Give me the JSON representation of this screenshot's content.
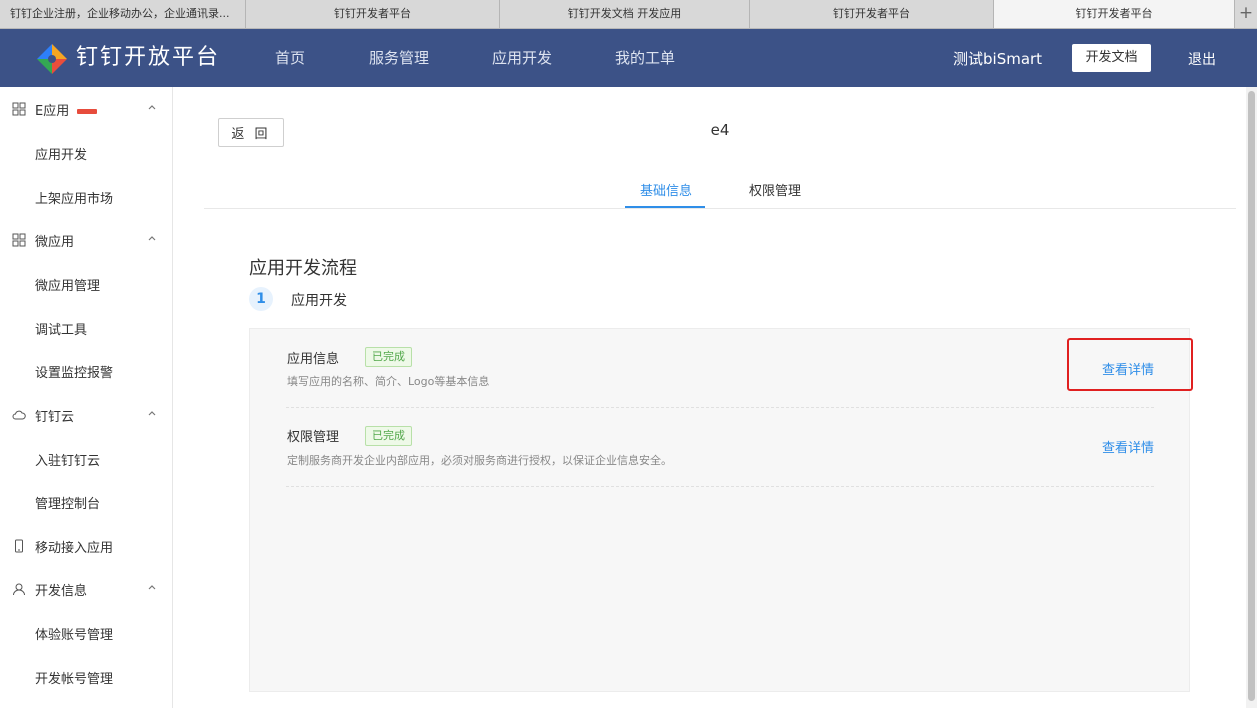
{
  "browser": {
    "tabs": [
      {
        "label": "钉钉企业注册，企业移动办公，企业通讯录..."
      },
      {
        "label": "钉钉开发者平台"
      },
      {
        "label": "钉钉开发文档 开发应用"
      },
      {
        "label": "钉钉开发者平台"
      },
      {
        "label": "钉钉开发者平台"
      }
    ],
    "new_tab": "+"
  },
  "header": {
    "brand": "钉钉开放平台",
    "nav": [
      "首页",
      "服务管理",
      "应用开发",
      "我的工单"
    ],
    "user": "测试biSmart",
    "docs_button": "开发文档",
    "logout": "退出",
    "bg_color": "#3c5287"
  },
  "sidebar": {
    "groups": [
      {
        "label": "E应用",
        "icon": "grid-icon",
        "items": [
          "应用开发",
          "上架应用市场"
        ]
      },
      {
        "label": "微应用",
        "icon": "grid-icon",
        "items": [
          "微应用管理",
          "调试工具",
          "设置监控报警"
        ]
      },
      {
        "label": "钉钉云",
        "icon": "cloud-icon",
        "items": [
          "入驻钉钉云",
          "管理控制台"
        ]
      },
      {
        "label": "移动接入应用",
        "icon": "phone-icon",
        "items": []
      },
      {
        "label": "开发信息",
        "icon": "user-icon",
        "items": [
          "体验账号管理",
          "开发帐号管理"
        ]
      }
    ]
  },
  "main": {
    "back_button": "返 回",
    "app_name": "e4",
    "tabs": [
      "基础信息",
      "权限管理"
    ],
    "section_title": "应用开发流程",
    "step_number": "1",
    "step_label": "应用开发",
    "rows": [
      {
        "title": "应用信息",
        "status": "已完成",
        "desc": "填写应用的名称、简介、Logo等基本信息",
        "link": "查看详情"
      },
      {
        "title": "权限管理",
        "status": "已完成",
        "desc": "定制服务商开发企业内部应用，必须对服务商进行授权，以保证企业信息安全。",
        "link": "查看详情"
      }
    ],
    "accent_color": "#2f8ee8"
  }
}
